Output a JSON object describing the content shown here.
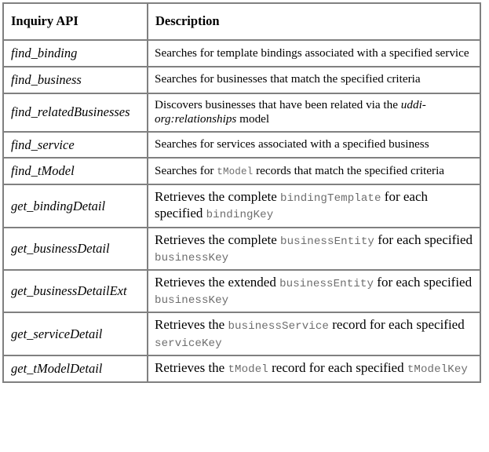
{
  "table": {
    "headers": [
      "Inquiry API",
      "Description"
    ],
    "rows": [
      {
        "api": "find_binding",
        "description": "Searches for template bindings associated with a specified service",
        "size": "sm",
        "parts": [
          {
            "type": "text",
            "text": "Searches for template bindings associated with a specified service"
          }
        ]
      },
      {
        "api": "find_business",
        "description": "Searches for businesses that match the specified criteria",
        "size": "sm",
        "parts": [
          {
            "type": "text",
            "text": "Searches for businesses that match the specified criteria"
          }
        ]
      },
      {
        "api": "find_relatedBusinesses",
        "description": "Discovers businesses that have been related via the uddi-org:relationships model",
        "size": "sm",
        "parts": [
          {
            "type": "text",
            "text": "Discovers businesses that have been related via the "
          },
          {
            "type": "italic",
            "text": "uddi-org:relationships"
          },
          {
            "type": "text",
            "text": " model"
          }
        ]
      },
      {
        "api": "find_service",
        "description": "Searches for services associated with a specified business",
        "size": "sm",
        "parts": [
          {
            "type": "text",
            "text": "Searches for services associated with a specified business"
          }
        ]
      },
      {
        "api": "find_tModel",
        "description": "Searches for tModel records that match the specified criteria",
        "size": "sm",
        "parts": [
          {
            "type": "text",
            "text": "Searches for "
          },
          {
            "type": "code",
            "text": "tModel"
          },
          {
            "type": "text",
            "text": " records that match the specified criteria"
          }
        ]
      },
      {
        "api": "get_bindingDetail",
        "description": "Retrieves the complete bindingTemplate for each specified bindingKey",
        "size": "lg",
        "parts": [
          {
            "type": "text",
            "text": "Retrieves the complete "
          },
          {
            "type": "code",
            "text": "bindingTemplate"
          },
          {
            "type": "text",
            "text": " for each specified "
          },
          {
            "type": "code",
            "text": "bindingKey"
          }
        ]
      },
      {
        "api": "get_businessDetail",
        "description": "Retrieves the complete businessEntity for each specified businessKey",
        "size": "lg",
        "parts": [
          {
            "type": "text",
            "text": "Retrieves the complete "
          },
          {
            "type": "code",
            "text": "businessEntity"
          },
          {
            "type": "text",
            "text": " for each specified "
          },
          {
            "type": "code",
            "text": "businessKey"
          }
        ]
      },
      {
        "api": "get_businessDetailExt",
        "description": "Retrieves the extended businessEntity for each specified businessKey",
        "size": "lg",
        "parts": [
          {
            "type": "text",
            "text": "Retrieves the extended "
          },
          {
            "type": "code",
            "text": "businessEntity"
          },
          {
            "type": "text",
            "text": " for each specified "
          },
          {
            "type": "code",
            "text": "businessKey"
          }
        ]
      },
      {
        "api": "get_serviceDetail",
        "description": "Retrieves the businessService record for each specified serviceKey",
        "size": "lg",
        "parts": [
          {
            "type": "text",
            "text": "Retrieves the "
          },
          {
            "type": "code",
            "text": "businessService"
          },
          {
            "type": "text",
            "text": " record for each specified "
          },
          {
            "type": "code",
            "text": "serviceKey"
          }
        ]
      },
      {
        "api": "get_tModelDetail",
        "description": "Retrieves the tModel record for each specified tModelKey",
        "size": "lg",
        "parts": [
          {
            "type": "text",
            "text": "Retrieves the "
          },
          {
            "type": "code",
            "text": "tModel"
          },
          {
            "type": "text",
            "text": " record for each specified "
          },
          {
            "type": "code",
            "text": "tModelKey"
          }
        ]
      }
    ]
  },
  "colors": {
    "border": "#808080",
    "text": "#000000",
    "code_text": "#6e6e6e",
    "background": "#ffffff"
  }
}
